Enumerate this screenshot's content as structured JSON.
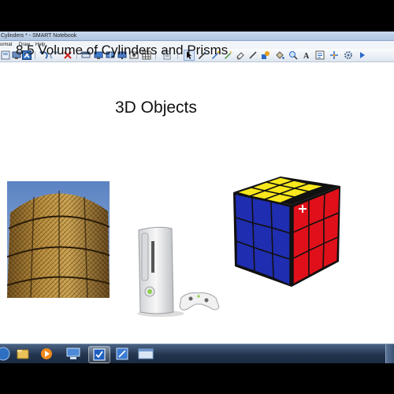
{
  "window": {
    "title": "Cylinders * - SMART Notebook"
  },
  "menu": {
    "items": [
      "ormat",
      "Draw",
      "Help"
    ]
  },
  "toolbar": {
    "buttons": [
      "page-sorter-icon",
      "screen-icon",
      "delete-page-icon",
      "undo-icon",
      "redo-icon",
      "delete-icon",
      "screen-shade-icon",
      "full-screen-icon",
      "dual-display-icon",
      "document-camera-icon",
      "screen-capture-icon",
      "table-icon",
      "select-icon",
      "pen-icon",
      "creative-pen-icon",
      "magic-pen-icon",
      "eraser-icon",
      "line-icon",
      "shapes-icon",
      "fill-icon",
      "text-icon",
      "properties-icon",
      "move-toolbar-icon"
    ]
  },
  "slide": {
    "heading": "8.5 Volume of Cylinders and Prisms",
    "subheading": "3D Objects",
    "images": [
      "silo-photo",
      "xbox-console-photo",
      "rubiks-cube-photo"
    ]
  },
  "taskbar": {
    "buttons": [
      "start-orb-icon",
      "explorer-icon",
      "media-player-icon",
      "network-icon",
      "smart-notebook-icon",
      "smart-board-icon",
      "window-icon"
    ]
  },
  "colors": {
    "cube_red": "#e0101a",
    "cube_blue": "#1f2db0",
    "cube_yellow": "#f8e71c",
    "taskbar": "#22354f"
  }
}
